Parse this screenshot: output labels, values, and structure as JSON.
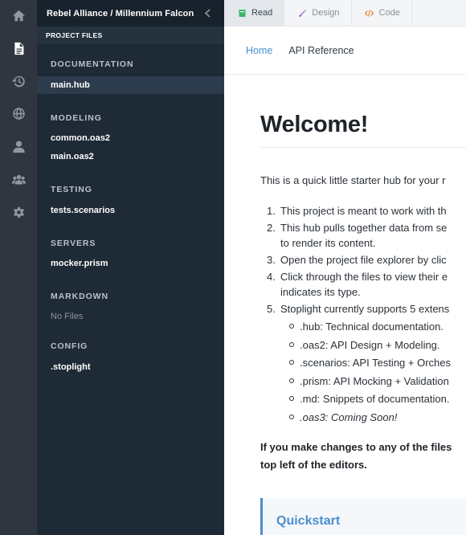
{
  "rail": {
    "items": [
      "home-icon",
      "file-icon",
      "history-icon",
      "globe-icon",
      "user-icon",
      "team-icon",
      "gear-icon"
    ],
    "active": "file-icon"
  },
  "sidebar": {
    "project_title": "Rebel Alliance  /  Millennium Falcon",
    "files_header": "PROJECT FILES",
    "sections": [
      {
        "label": "DOCUMENTATION",
        "files": [
          "main.hub"
        ]
      },
      {
        "label": "MODELING",
        "files": [
          "common.oas2",
          "main.oas2"
        ]
      },
      {
        "label": "TESTING",
        "files": [
          "tests.scenarios"
        ]
      },
      {
        "label": "SERVERS",
        "files": [
          "mocker.prism"
        ]
      },
      {
        "label": "MARKDOWN",
        "empty_text": "No Files"
      },
      {
        "label": "CONFIG",
        "files": [
          ".stoplight"
        ]
      }
    ],
    "selected_file": "main.hub"
  },
  "tabs": [
    {
      "label": "Read",
      "icon": "book-icon",
      "color": "#3bb56a",
      "active": true
    },
    {
      "label": "Design",
      "icon": "brush-icon",
      "color": "#9b59d0",
      "active": false
    },
    {
      "label": "Code",
      "icon": "code-icon",
      "color": "#e67e22",
      "active": false
    }
  ],
  "subnav": {
    "home": "Home",
    "api": "API Reference"
  },
  "content": {
    "title": "Welcome!",
    "intro": "This is a quick little starter hub for your r",
    "steps": [
      {
        "num": "1.",
        "lines": [
          "This project is meant to work with th"
        ]
      },
      {
        "num": "2.",
        "lines": [
          "This hub pulls together data from se",
          "to render its content."
        ]
      },
      {
        "num": "3.",
        "lines": [
          "Open the project file explorer by clic"
        ]
      },
      {
        "num": "4.",
        "lines": [
          "Click through the files to view their e",
          "indicates its type."
        ]
      },
      {
        "num": "5.",
        "lines": [
          "Stoplight currently supports 5 extens"
        ]
      }
    ],
    "extensions": [
      {
        "text": ".hub: Technical documentation.",
        "italic": false
      },
      {
        "text": ".oas2: API Design + Modeling.",
        "italic": false
      },
      {
        "text": ".scenarios: API Testing + Orches",
        "italic": false
      },
      {
        "text": ".prism: API Mocking + Validation",
        "italic": false
      },
      {
        "text": ".md: Snippets of documentation.",
        "italic": false
      },
      {
        "text": ".oas3: Coming Soon!",
        "italic": true
      }
    ],
    "note_lines": [
      "If you make changes to any of the files",
      "top left of the editors."
    ],
    "quickstart": "Quickstart"
  },
  "colors": {
    "rail_bg": "#2f3640",
    "sidebar_bg": "#1e2a36",
    "accent": "#4a8fd0",
    "read_green": "#3bb56a",
    "design_purple": "#9b59d0",
    "code_orange": "#e67e22"
  }
}
